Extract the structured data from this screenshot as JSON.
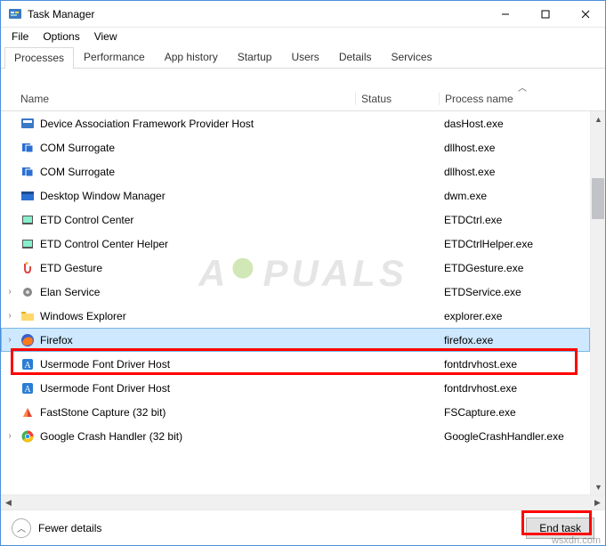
{
  "window": {
    "title": "Task Manager"
  },
  "menu": {
    "file": "File",
    "options": "Options",
    "view": "View"
  },
  "tabs": [
    "Processes",
    "Performance",
    "App history",
    "Startup",
    "Users",
    "Details",
    "Services"
  ],
  "activeTab": 0,
  "columns": {
    "name": "Name",
    "status": "Status",
    "proc": "Process name"
  },
  "rows": [
    {
      "expander": "",
      "icon": "svc",
      "name": "Device Association Framework Provider Host",
      "status": "",
      "proc": "dasHost.exe"
    },
    {
      "expander": "",
      "icon": "com",
      "name": "COM Surrogate",
      "status": "",
      "proc": "dllhost.exe"
    },
    {
      "expander": "",
      "icon": "com",
      "name": "COM Surrogate",
      "status": "",
      "proc": "dllhost.exe"
    },
    {
      "expander": "",
      "icon": "dwm",
      "name": "Desktop Window Manager",
      "status": "",
      "proc": "dwm.exe"
    },
    {
      "expander": "",
      "icon": "etd",
      "name": "ETD Control Center",
      "status": "",
      "proc": "ETDCtrl.exe"
    },
    {
      "expander": "",
      "icon": "etd",
      "name": "ETD Control Center Helper",
      "status": "",
      "proc": "ETDCtrlHelper.exe"
    },
    {
      "expander": "",
      "icon": "gest",
      "name": "ETD Gesture",
      "status": "",
      "proc": "ETDGesture.exe"
    },
    {
      "expander": "›",
      "icon": "gear",
      "name": "Elan Service",
      "status": "",
      "proc": "ETDService.exe"
    },
    {
      "expander": "›",
      "icon": "expl",
      "name": "Windows Explorer",
      "status": "",
      "proc": "explorer.exe"
    },
    {
      "expander": "›",
      "icon": "ff",
      "name": "Firefox",
      "status": "",
      "proc": "firefox.exe",
      "selected": true
    },
    {
      "expander": "",
      "icon": "font",
      "name": "Usermode Font Driver Host",
      "status": "",
      "proc": "fontdrvhost.exe"
    },
    {
      "expander": "",
      "icon": "font",
      "name": "Usermode Font Driver Host",
      "status": "",
      "proc": "fontdrvhost.exe"
    },
    {
      "expander": "",
      "icon": "fs",
      "name": "FastStone Capture (32 bit)",
      "status": "",
      "proc": "FSCapture.exe"
    },
    {
      "expander": "›",
      "icon": "gc",
      "name": "Google Crash Handler (32 bit)",
      "status": "",
      "proc": "GoogleCrashHandler.exe"
    }
  ],
  "footer": {
    "fewer": "Fewer details",
    "endtask": "End task"
  },
  "watermark": "A  PUALS",
  "attribution": "wsxdn.com"
}
